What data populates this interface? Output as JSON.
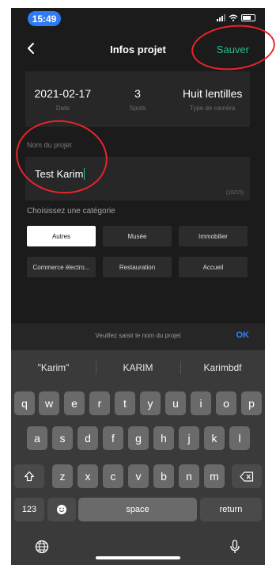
{
  "status_bar": {
    "time": "15:49"
  },
  "nav": {
    "title": "Infos projet",
    "save_label": "Sauver"
  },
  "summary": [
    {
      "value": "2021-02-17",
      "label": "Date"
    },
    {
      "value": "3",
      "label": "Spots"
    },
    {
      "value": "Huit lentilles",
      "label": "Type de caméra"
    }
  ],
  "project_name": {
    "label": "Nom du projet",
    "value": "Test Karim",
    "counter": "(10/15)"
  },
  "category": {
    "label": "Choisissez une catégorie",
    "options": [
      "Autres",
      "Musée",
      "Immobilier",
      "Commerce électro...",
      "Restauration",
      "Accueil"
    ],
    "selected": "Autres"
  },
  "accessory": {
    "hint": "Veuillez saisir le nom du projet",
    "ok_label": "OK"
  },
  "keyboard": {
    "suggestions": [
      "\"Karim\"",
      "KARIM",
      "Karimbdf"
    ],
    "row1": [
      "q",
      "w",
      "e",
      "r",
      "t",
      "y",
      "u",
      "i",
      "o",
      "p"
    ],
    "row2": [
      "a",
      "s",
      "d",
      "f",
      "g",
      "h",
      "j",
      "k",
      "l"
    ],
    "row3": [
      "z",
      "x",
      "c",
      "v",
      "b",
      "n",
      "m"
    ],
    "numbers_label": "123",
    "space_label": "space",
    "return_label": "return"
  },
  "colors": {
    "accent": "#24c38b",
    "ok": "#2f83ff",
    "annotation": "#e8242c",
    "time_pill": "#2f7bf5"
  },
  "icons": [
    "back-chevron-icon",
    "signal-icon",
    "wifi-icon",
    "battery-icon",
    "shift-icon",
    "backspace-icon",
    "emoji-icon",
    "globe-icon",
    "microphone-icon"
  ]
}
